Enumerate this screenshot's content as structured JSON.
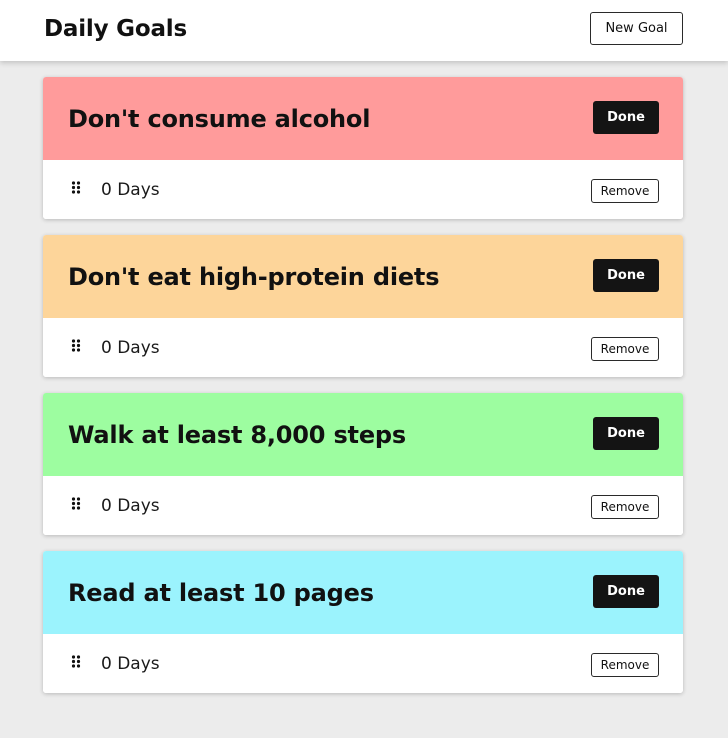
{
  "header": {
    "title": "Daily Goals",
    "new_goal_label": "New Goal"
  },
  "goals": [
    {
      "title": "Don't consume alcohol",
      "color": "#ff9b9b",
      "done_label": "Done",
      "streak": "0 Days",
      "remove_label": "Remove",
      "handle_icon": "drag-handle-icon"
    },
    {
      "title": "Don't eat high-protein diets",
      "color": "#fdd59a",
      "done_label": "Done",
      "streak": "0 Days",
      "remove_label": "Remove",
      "handle_icon": "drag-handle-icon"
    },
    {
      "title": "Walk at least 8,000 steps",
      "color": "#9dfda0",
      "done_label": "Done",
      "streak": "0 Days",
      "remove_label": "Remove",
      "handle_icon": "drag-handle-icon"
    },
    {
      "title": "Read at least 10 pages",
      "color": "#9bf3fd",
      "done_label": "Done",
      "streak": "0 Days",
      "remove_label": "Remove",
      "handle_icon": "drag-handle-icon"
    }
  ]
}
